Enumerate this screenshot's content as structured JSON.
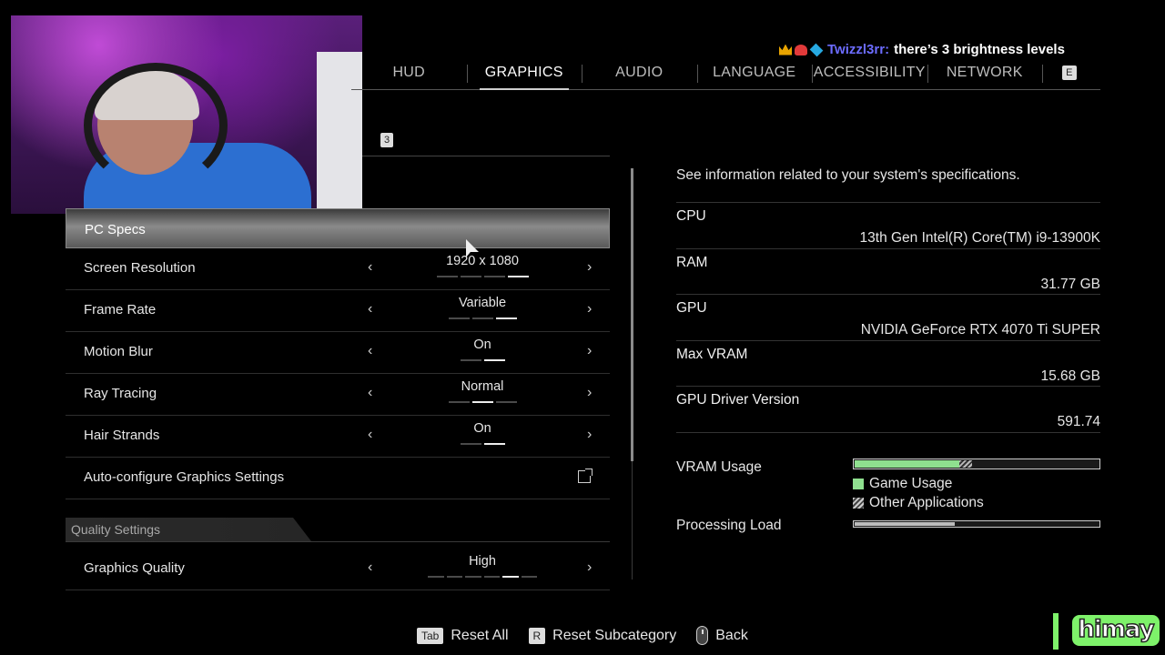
{
  "chat": {
    "username": "Twizzl3rr:",
    "message": "there’s 3 brightness levels",
    "badges": [
      "crown-icon",
      "rocket-icon",
      "cube-icon"
    ]
  },
  "tabs": [
    {
      "label": "HUD",
      "active": false
    },
    {
      "label": "GRAPHICS",
      "active": true
    },
    {
      "label": "AUDIO",
      "active": false
    },
    {
      "label": "LANGUAGE",
      "active": false
    },
    {
      "label": "ACCESSIBILITY",
      "active": false
    },
    {
      "label": "NETWORK",
      "active": false
    }
  ],
  "tab_next_key": "E",
  "subtab_key": "3",
  "settings": {
    "header": "PC Specs",
    "rows": [
      {
        "label": "Screen Resolution",
        "value": "1920 x 1080",
        "options": 4,
        "selected": 3
      },
      {
        "label": "Frame Rate",
        "value": "Variable",
        "options": 3,
        "selected": 2
      },
      {
        "label": "Motion Blur",
        "value": "On",
        "options": 2,
        "selected": 1
      },
      {
        "label": "Ray Tracing",
        "value": "Normal",
        "options": 3,
        "selected": 1
      },
      {
        "label": "Hair Strands",
        "value": "On",
        "options": 2,
        "selected": 1
      }
    ],
    "auto_configure": "Auto-configure Graphics Settings",
    "section": "Quality Settings",
    "quality": {
      "label": "Graphics Quality",
      "value": "High",
      "options": 6,
      "selected": 4
    }
  },
  "info": {
    "intro": "See information related to your system's specifications.",
    "specs": [
      {
        "name": "CPU",
        "value": "13th Gen Intel(R) Core(TM) i9-13900K"
      },
      {
        "name": "RAM",
        "value": "31.77 GB"
      },
      {
        "name": "GPU",
        "value": "NVIDIA GeForce RTX 4070 Ti SUPER"
      },
      {
        "name": "Max VRAM",
        "value": "15.68 GB"
      },
      {
        "name": "GPU Driver Version",
        "value": "591.74"
      }
    ],
    "vram_usage": {
      "label": "VRAM Usage",
      "game_fraction": 0.43,
      "other_fraction": 0.05
    },
    "legend_game": "Game Usage",
    "legend_other": "Other Applications",
    "processing_load": {
      "label": "Processing Load",
      "fraction": 0.41
    }
  },
  "hints": [
    {
      "key": "Tab",
      "label": "Reset All"
    },
    {
      "key": "R",
      "label": "Reset Subcategory"
    },
    {
      "key": "mouse-icon",
      "label": "Back"
    }
  ],
  "logo_text": "himay",
  "colors": {
    "game_usage": "#8fe08f",
    "logo": "#7ef26a",
    "chat_user": "#6c6cff"
  }
}
